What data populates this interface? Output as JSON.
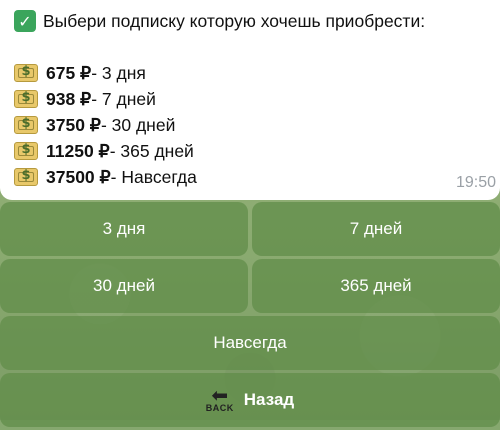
{
  "message": {
    "title": "Выбери подписку которую хочешь приобрести:",
    "check_icon": "check-mark-button-icon",
    "items": [
      {
        "icon": "money-bag-icon",
        "amount": "675 ₽",
        "period": " - 3 дня"
      },
      {
        "icon": "money-bag-icon",
        "amount": "938 ₽",
        "period": " - 7 дней"
      },
      {
        "icon": "money-bag-icon",
        "amount": "3750 ₽",
        "period": " - 30 дней"
      },
      {
        "icon": "money-bag-icon",
        "amount": "11250 ₽",
        "period": " - 365 дней"
      },
      {
        "icon": "money-bag-icon",
        "amount": "37500 ₽",
        "period": " - Навсегда"
      }
    ],
    "time": "19:50"
  },
  "keyboard": {
    "buttons": {
      "b3": "3 дня",
      "b7": "7 дней",
      "b30": "30 дней",
      "b365": "365 дней",
      "forever": "Навсегда",
      "back": "Назад",
      "back_icon_text": "BACK"
    }
  },
  "colors": {
    "check_green": "#3ba55c",
    "bubble": "#ffffff",
    "button_bg": "#608c48"
  }
}
